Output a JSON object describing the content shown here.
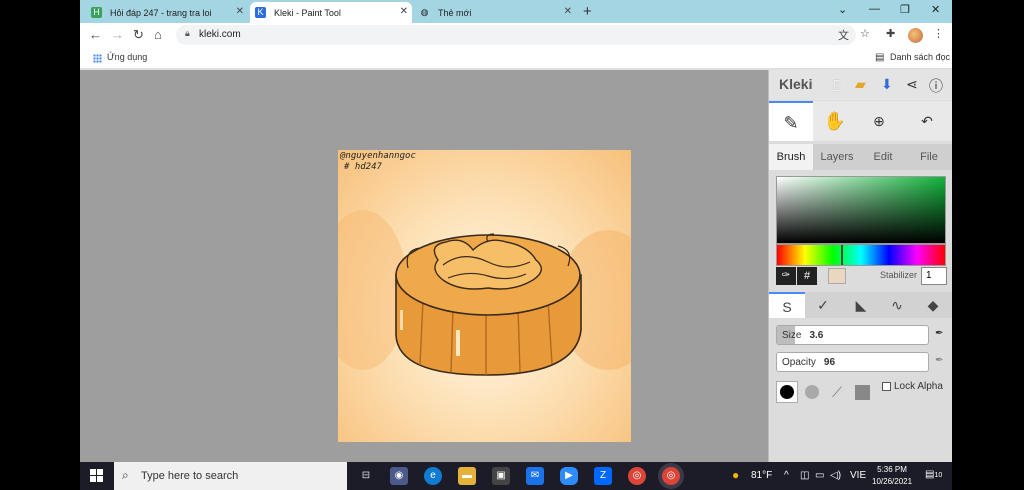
{
  "browser": {
    "tabs": [
      {
        "title": "Hỏi đáp 247 - trang tra loi",
        "active": false
      },
      {
        "title": "Kleki - Paint Tool",
        "active": true
      },
      {
        "title": "Thẻ mới",
        "active": false
      }
    ],
    "url": "kleki.com",
    "bookmarks": {
      "apps": "Ứng dụng",
      "reading_list": "Danh sách đọc"
    }
  },
  "canvas": {
    "signature_line1": "@nguyenhanngoc",
    "signature_line2": "# hd247",
    "colors": {
      "cake_main": "#f0a94a",
      "cake_dark": "#c2752a",
      "outline": "#3a2a1a",
      "background": "#fde2b8"
    }
  },
  "app": {
    "name": "Kleki",
    "tabs": [
      "Brush",
      "Layers",
      "Edit",
      "File"
    ],
    "active_tab": "Brush",
    "stabilizer_label": "Stabilizer",
    "stabilizer_value": "1",
    "color_hash": "#",
    "size_label": "Size",
    "size_value": "3.6",
    "opacity_label": "Opacity",
    "opacity_value": "96",
    "lock_alpha_label": "Lock Alpha",
    "selected_color": "#ead7bf"
  },
  "taskbar": {
    "search_placeholder": "Type here to search",
    "weather": "81°F",
    "lang": "VIE",
    "time": "5:36 PM",
    "date": "10/26/2021",
    "notifications": "10"
  }
}
